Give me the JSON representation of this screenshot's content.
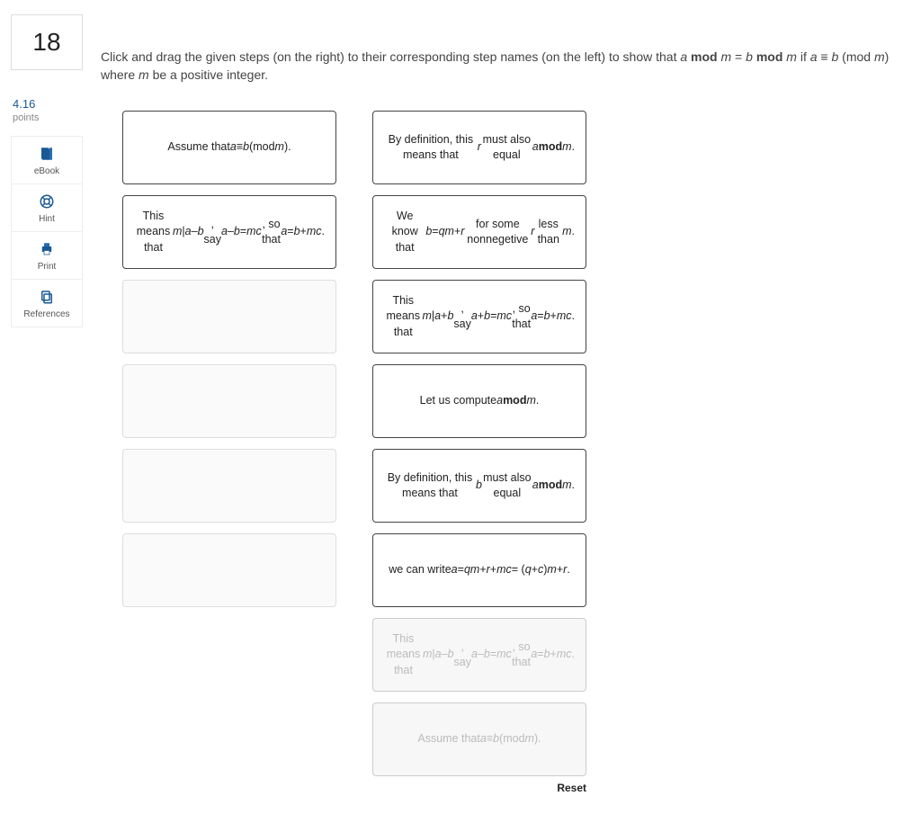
{
  "question_number": "18",
  "points_value": "4.16",
  "points_label": "points",
  "tools": {
    "ebook": "eBook",
    "hint": "Hint",
    "print": "Print",
    "references": "References"
  },
  "instructions_html": "Click and drag the given steps (on the right) to their corresponding step names (on the left) to show that <span class='it'>a</span> <span class='b'>mod</span> <span class='it'>m</span> = <span class='it'>b</span> <span class='b'>mod</span> <span class='it'>m</span> if <span class='it'>a</span> ≡ <span class='it'>b</span> (mod <span class='it'>m</span>) where <span class='it'>m</span> be a positive integer.",
  "left_slots": [
    {
      "filled": true,
      "html": "Assume that <span class='it'>a</span> ≡ <span class='it'>b</span> (mod <span class='it'>m</span>)."
    },
    {
      "filled": true,
      "html": "This means that <span class='it'>m</span> | <span class='it'>a</span> – <span class='it'>b</span>, say <span class='it'>a</span> – <span class='it'>b</span> = <span class='it'>mc</span>, so that <span class='it'>a</span> = <span class='it'>b</span> + <span class='it'>mc</span>."
    },
    {
      "filled": false,
      "html": ""
    },
    {
      "filled": false,
      "html": ""
    },
    {
      "filled": false,
      "html": ""
    },
    {
      "filled": false,
      "html": ""
    }
  ],
  "right_steps": [
    {
      "ghost": false,
      "html": "By definition, this means that <span class='it'>r</span> must also equal <span class='it'>a</span> <span class='b'>mod</span> <span class='it'>m</span>."
    },
    {
      "ghost": false,
      "html": "We know that <span class='it'>b</span> = <span class='it'>qm</span> + <span class='it'>r</span> for some nonnegetive <span class='it'>r</span> less than <span class='it'>m</span>."
    },
    {
      "ghost": false,
      "html": "This means that <span class='it'>m</span> | <span class='it'>a</span> + <span class='it'>b</span>, say <span class='it'>a</span> + <span class='it'>b</span> = <span class='it'>mc</span>, so that <span class='it'>a</span> = <span class='it'>b</span> + <span class='it'>mc</span>."
    },
    {
      "ghost": false,
      "html": "Let us compute <span class='it'>a</span> <span class='b'>mod</span> <span class='it'>m</span>."
    },
    {
      "ghost": false,
      "html": "By definition, this means that <span class='it'>b</span> must also equal <span class='it'>a</span> <span class='b'>mod</span> <span class='it'>m</span>."
    },
    {
      "ghost": false,
      "html": "we can write <span class='it'>a</span> = <span class='it'>qm</span> + <span class='it'>r</span> + <span class='it'>mc</span> = (<span class='it'>q</span> + <span class='it'>c</span>)<span class='it'>m</span> + <span class='it'>r</span>."
    },
    {
      "ghost": true,
      "html": "This means that <span class='it'>m</span> | <span class='it'>a</span> – <span class='it'>b</span>, say <span class='it'>a</span> – <span class='it'>b</span> = <span class='it'>mc</span>, so that <span class='it'>a</span> = <span class='it'>b</span> + <span class='it'>mc</span>."
    },
    {
      "ghost": true,
      "html": "Assume that <span class='it'>a</span> ≡ <span class='it'>b</span> (mod <span class='it'>m</span>)."
    }
  ],
  "reset_label": "Reset"
}
